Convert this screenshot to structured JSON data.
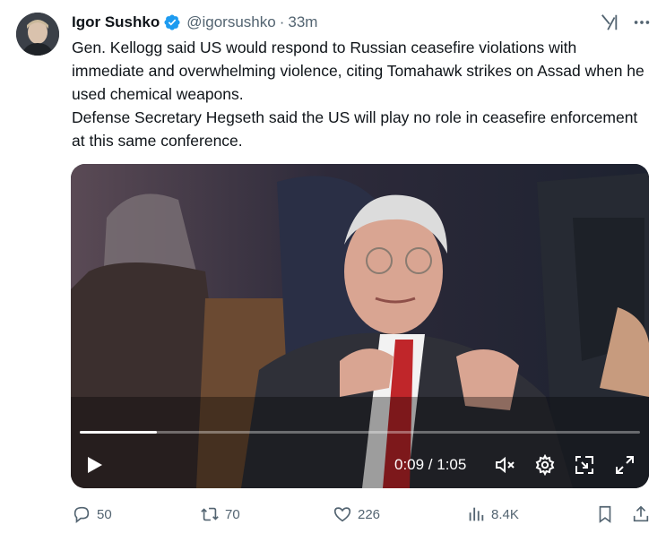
{
  "user": {
    "display_name": "Igor Sushko",
    "handle": "@igorsushko",
    "separator": "·",
    "time": "33m"
  },
  "tweet": {
    "paragraphs": [
      "Gen. Kellogg said US would respond to Russian ceasefire violations with immediate and overwhelming violence, citing Tomahawk strikes on Assad when he used chemical weapons.",
      "Defense Secretary Hegseth said the US will play no role in ceasefire enforcement at this same conference."
    ]
  },
  "video": {
    "current_time": "0:09",
    "duration": "1:05",
    "time_display": "0:09 / 1:05",
    "progress_fraction": 0.138
  },
  "actions": {
    "replies": "50",
    "reposts": "70",
    "likes": "226",
    "views": "8.4K"
  },
  "colors": {
    "verified": "#1d9bf0",
    "secondary_text": "#536471",
    "primary_text": "#0f1419"
  },
  "icons": [
    "verified-badge-icon",
    "grok-icon",
    "more-icon",
    "play-icon",
    "mute-icon",
    "settings-icon",
    "pip-icon",
    "fullscreen-icon",
    "reply-icon",
    "repost-icon",
    "like-icon",
    "views-icon",
    "bookmark-icon",
    "share-icon"
  ]
}
